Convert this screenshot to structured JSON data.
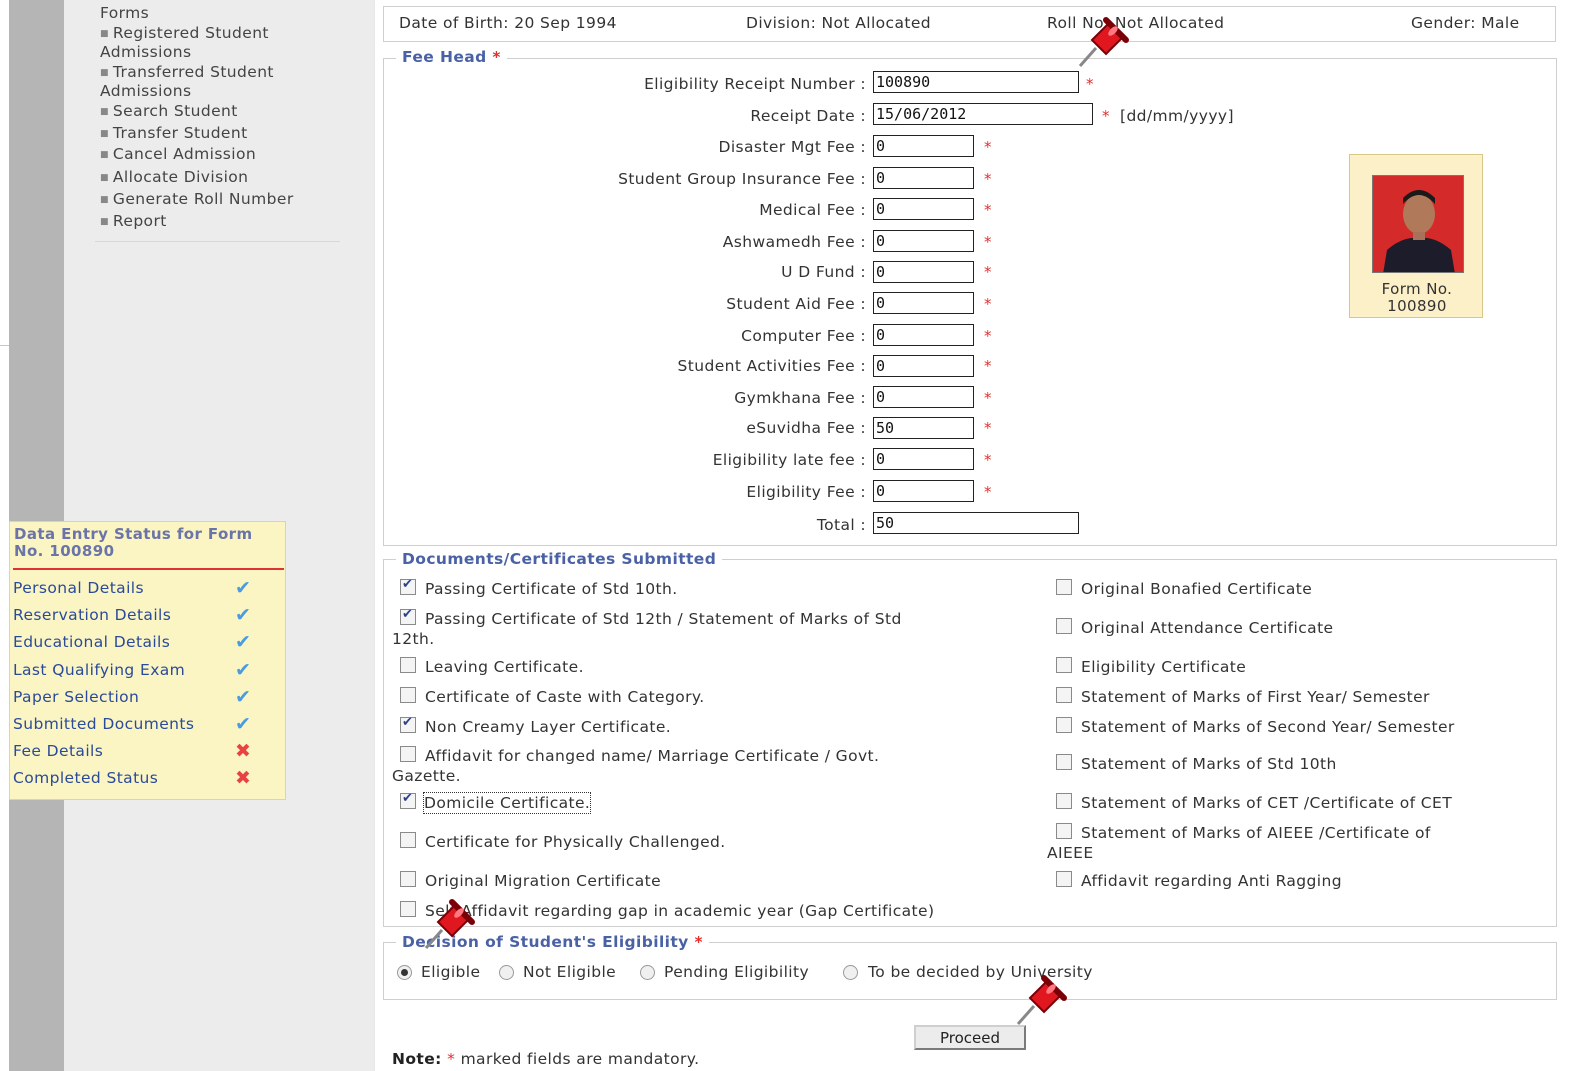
{
  "sidebar": {
    "items": [
      {
        "label": "Forms",
        "bullet": false
      },
      {
        "label": "Registered Student",
        "bullet": true
      },
      {
        "label": "Admissions",
        "bullet": false
      },
      {
        "label": "Transferred Student",
        "bullet": true
      },
      {
        "label": "Admissions",
        "bullet": false
      },
      {
        "label": "Search Student",
        "bullet": true
      },
      {
        "label": "Transfer Student",
        "bullet": true
      },
      {
        "label": "Cancel Admission",
        "bullet": true
      },
      {
        "label": "Allocate Division",
        "bullet": true
      },
      {
        "label": "Generate Roll Number",
        "bullet": true
      },
      {
        "label": "Report",
        "bullet": true
      }
    ]
  },
  "status_panel": {
    "title": "Data Entry Status for Form No. 100890",
    "rows": [
      {
        "label": "Personal Details",
        "status": "done"
      },
      {
        "label": "Reservation Details",
        "status": "done"
      },
      {
        "label": "Educational Details",
        "status": "done"
      },
      {
        "label": "Last Qualifying Exam",
        "status": "done"
      },
      {
        "label": "Paper Selection",
        "status": "done"
      },
      {
        "label": "Submitted Documents",
        "status": "done"
      },
      {
        "label": "Fee Details",
        "status": "pending"
      },
      {
        "label": "Completed Status",
        "status": "pending"
      }
    ],
    "icon_done": "✔",
    "icon_pending": "✖"
  },
  "info": {
    "dob": "Date of Birth: 20 Sep 1994",
    "division": "Division: Not Allocated",
    "roll": "Roll No: Not Allocated",
    "gender": "Gender: Male"
  },
  "fee_head": {
    "legend": "Fee Head",
    "fields": [
      {
        "label": "Eligibility Receipt Number :",
        "value": "100890"
      },
      {
        "label": "Receipt Date :",
        "value": "15/06/2012",
        "hint": "[dd/mm/yyyy]"
      },
      {
        "label": "Disaster Mgt Fee :",
        "value": "0"
      },
      {
        "label": "Student Group Insurance Fee :",
        "value": "0"
      },
      {
        "label": "Medical Fee :",
        "value": "0"
      },
      {
        "label": "Ashwamedh Fee :",
        "value": "0"
      },
      {
        "label": "U D Fund :",
        "value": "0"
      },
      {
        "label": "Student Aid Fee :",
        "value": "0"
      },
      {
        "label": "Computer Fee :",
        "value": "0"
      },
      {
        "label": "Student Activities Fee :",
        "value": "0"
      },
      {
        "label": "Gymkhana Fee :",
        "value": "0"
      },
      {
        "label": "eSuvidha Fee :",
        "value": "50"
      },
      {
        "label": "Eligibility late fee :",
        "value": "0"
      },
      {
        "label": "Eligibility Fee :",
        "value": "0"
      },
      {
        "label": "Total :",
        "value": "50"
      }
    ],
    "required_mark": "*",
    "photo_caption_1": "Form No.",
    "photo_caption_2": "100890"
  },
  "documents": {
    "legend": "Documents/Certificates Submitted",
    "left": [
      {
        "label": "Passing Certificate of Std 10th.",
        "checked": true
      },
      {
        "label": "Passing Certificate of Std 12th / Statement of Marks of Std",
        "label2": "12th.",
        "checked": true
      },
      {
        "label": "Leaving Certificate.",
        "checked": false
      },
      {
        "label": "Certificate of Caste with Category.",
        "checked": false
      },
      {
        "label": "Non Creamy Layer Certificate.",
        "checked": true
      },
      {
        "label": "Affidavit for changed name/ Marriage Certificate / Govt.",
        "label2": "Gazette.",
        "checked": false
      },
      {
        "label": "Domicile Certificate.",
        "checked": true
      },
      {
        "label": "Certificate for Physically Challenged.",
        "checked": false
      },
      {
        "label": "Original Migration Certificate",
        "checked": false
      },
      {
        "label": "Self Affidavit regarding gap in academic year (Gap Certificate)",
        "checked": false
      }
    ],
    "right": [
      {
        "label": "Original Bonafied Certificate",
        "checked": false
      },
      {
        "label": "Original Attendance Certificate",
        "checked": false
      },
      {
        "label": "Eligibility Certificate",
        "checked": false
      },
      {
        "label": "Statement of Marks of First Year/ Semester",
        "checked": false
      },
      {
        "label": "Statement of Marks of Second Year/ Semester",
        "checked": false
      },
      {
        "label": "Statement of Marks of Std 10th",
        "checked": false
      },
      {
        "label": "Statement of Marks of CET /Certificate of CET",
        "checked": false
      },
      {
        "label": "Statement of Marks of AIEEE /Certificate of",
        "label2": "AIEEE",
        "checked": false
      },
      {
        "label": "Affidavit regarding Anti Ragging",
        "checked": false
      }
    ]
  },
  "decision": {
    "legend": "Decision of Student's Eligibility",
    "options": [
      "Eligible",
      "Not Eligible",
      "Pending Eligibility",
      "To be decided by University"
    ],
    "selected": 0
  },
  "actions": {
    "proceed_label": "Proceed"
  },
  "note": {
    "label": "Note:",
    "star": "*",
    "text": "marked fields are mandatory."
  },
  "colors": {
    "accent": "#4a62a5",
    "required": "#e23030",
    "panel": "#fbf5c4"
  }
}
